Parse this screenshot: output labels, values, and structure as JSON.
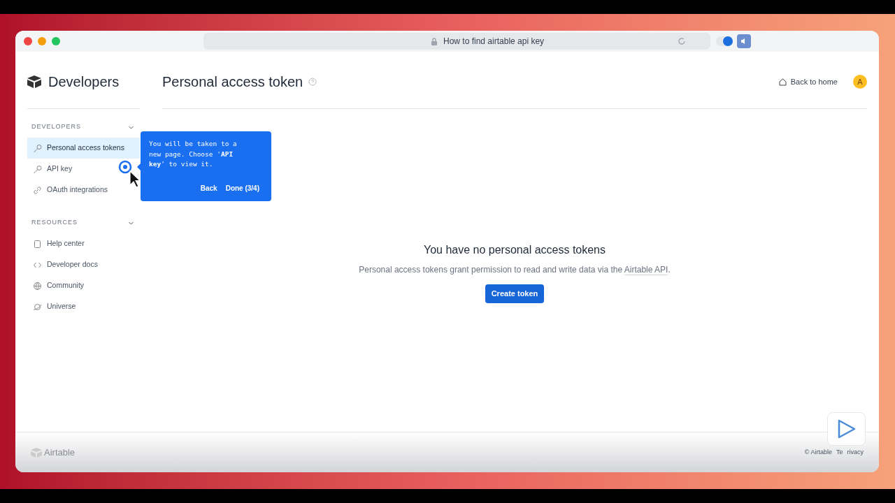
{
  "browser": {
    "address": "How to find airtable api key",
    "play_toggle": {
      "on": true
    }
  },
  "sidebar": {
    "title": "Developers",
    "sections": [
      {
        "heading": "DEVELOPERS",
        "expanded": true,
        "items": [
          {
            "label": "Personal access tokens",
            "kind": "key",
            "selected": true
          },
          {
            "label": "API key",
            "kind": "key",
            "selected": false
          },
          {
            "label": "OAuth integrations",
            "kind": "link",
            "selected": false
          }
        ]
      },
      {
        "heading": "RESOURCES",
        "expanded": true,
        "items": [
          {
            "label": "Help center",
            "kind": "book",
            "selected": false
          },
          {
            "label": "Developer docs",
            "kind": "code",
            "selected": false
          },
          {
            "label": "Community",
            "kind": "globe",
            "selected": false
          },
          {
            "label": "Universe",
            "kind": "planet",
            "selected": false
          }
        ]
      }
    ]
  },
  "page": {
    "title": "Personal access token",
    "back_link": "Back to home",
    "avatar": "A"
  },
  "empty_state": {
    "heading": "You have no personal access tokens",
    "text": "Personal access tokens grant permission to read and write data via the",
    "link": "Airtable API",
    "text_end": ".",
    "button": "Create token"
  },
  "tour_popup": {
    "text": "You will be taken to a new page. Choose '**API key**' to view it.",
    "buttons": [
      "Back",
      "Done (3/4)"
    ]
  },
  "footer": {
    "brand": "Airtable",
    "links": [
      "© Airtable",
      "Te",
      "rivacy"
    ]
  }
}
